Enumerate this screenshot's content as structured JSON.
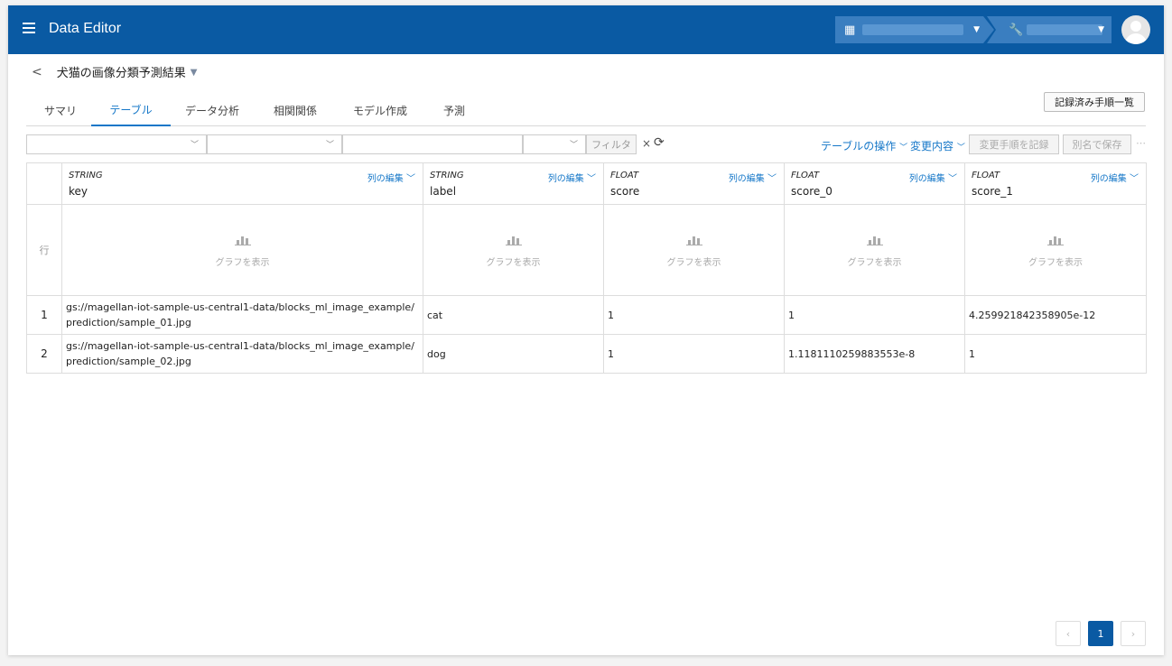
{
  "app": {
    "title": "Data Editor"
  },
  "page": {
    "title": "犬猫の画像分類予測結果"
  },
  "tabs": [
    "サマリ",
    "テーブル",
    "データ分析",
    "相関関係",
    "モデル作成",
    "予測"
  ],
  "active_tab": "テーブル",
  "records_button": "記録済み手順一覧",
  "toolbar": {
    "filter": "フィルタ",
    "clear": "×",
    "table_ops": "テーブルの操作",
    "changes": "変更内容",
    "record_steps": "変更手順を記録",
    "save_as": "別名で保存",
    "more": "⋯"
  },
  "table": {
    "row_header": "行",
    "edit_label": "列の編集",
    "graph_label": "グラフを表示",
    "columns": [
      {
        "type": "STRING",
        "name": "key"
      },
      {
        "type": "STRING",
        "name": "label"
      },
      {
        "type": "FLOAT",
        "name": "score"
      },
      {
        "type": "FLOAT",
        "name": "score_0"
      },
      {
        "type": "FLOAT",
        "name": "score_1"
      }
    ],
    "rows": [
      {
        "num": "1",
        "cells": [
          "gs://magellan-iot-sample-us-central1-data/blocks_ml_image_example/prediction/sample_01.jpg",
          "cat",
          "1",
          "1",
          "4.259921842358905e-12"
        ]
      },
      {
        "num": "2",
        "cells": [
          "gs://magellan-iot-sample-us-central1-data/blocks_ml_image_example/prediction/sample_02.jpg",
          "dog",
          "1",
          "1.1181110259883553e-8",
          "1"
        ]
      }
    ]
  },
  "pagination": {
    "prev": "‹",
    "current": "1",
    "next": "›"
  },
  "colors": {
    "header_bg": "#0a5aa3",
    "accent": "#1577c8"
  }
}
